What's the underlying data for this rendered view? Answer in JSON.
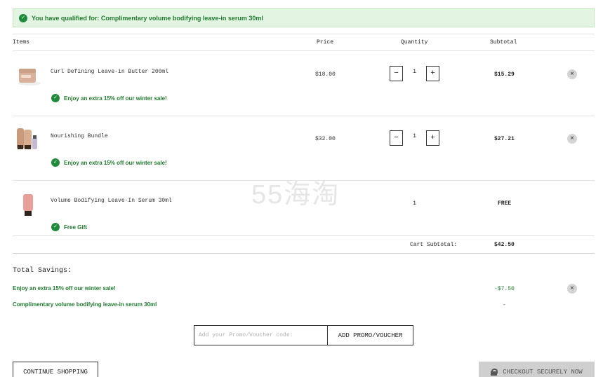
{
  "banner": {
    "text": "You have qualified for: Complimentary volume bodifying leave-in serum 30ml",
    "icon": "check-circle-icon",
    "color": "#1e7a2c"
  },
  "table": {
    "headers": {
      "items": "Items",
      "price": "Price",
      "quantity": "Quantity",
      "subtotal": "Subtotal"
    }
  },
  "items": [
    {
      "name": "Curl Defining Leave-in Butter 200ml",
      "promo": "Enjoy an extra 15% off our winter sale!",
      "price": "$18.00",
      "quantity": "1",
      "subtotal": "$15.29"
    },
    {
      "name": "Nourishing Bundle",
      "promo": "Enjoy an extra 15% off our winter sale!",
      "price": "$32.00",
      "quantity": "1",
      "subtotal": "$27.21"
    },
    {
      "name": "Volume Bodifying Leave-In Serum 30ml",
      "promo": "Free Gift",
      "price": "",
      "quantity": "1",
      "subtotal": "FREE"
    }
  ],
  "qty_buttons": {
    "minus": "−",
    "plus": "+"
  },
  "cart": {
    "subtotal_label": "Cart Subtotal:",
    "subtotal_value": "$42.50"
  },
  "watermark": "55海淘",
  "savings": {
    "title": "Total Savings:",
    "lines": [
      {
        "label": "Enjoy an extra 15% off our winter sale!",
        "value": "-$7.50"
      },
      {
        "label": "Complimentary volume bodifying leave-in serum 30ml",
        "value": "-"
      }
    ]
  },
  "promo": {
    "placeholder": "Add your Promo/Voucher code:",
    "button": "ADD PROMO/VOUCHER"
  },
  "actions": {
    "continue": "CONTINUE SHOPPING",
    "checkout": "CHECKOUT SECURELY NOW"
  },
  "colors": {
    "accent_green": "#1e7a2c",
    "banner_bg": "#e4f4e2",
    "checkout_bg": "#cfcfcf"
  }
}
